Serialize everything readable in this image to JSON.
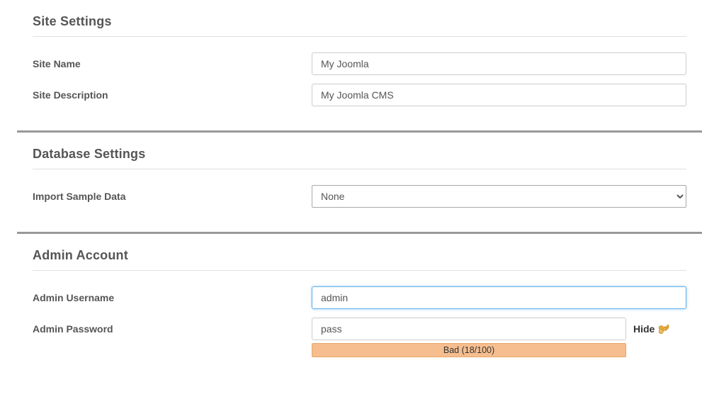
{
  "sections": {
    "site": {
      "title": "Site Settings",
      "site_name": {
        "label": "Site Name",
        "value": "My Joomla"
      },
      "site_description": {
        "label": "Site Description",
        "value": "My Joomla CMS"
      }
    },
    "database": {
      "title": "Database Settings",
      "import_sample": {
        "label": "Import Sample Data",
        "value": "None"
      }
    },
    "admin": {
      "title": "Admin Account",
      "username": {
        "label": "Admin Username",
        "value": "admin"
      },
      "password": {
        "label": "Admin Password",
        "value": "pass",
        "toggle": "Hide",
        "strength": "Bad (18/100)"
      }
    }
  }
}
